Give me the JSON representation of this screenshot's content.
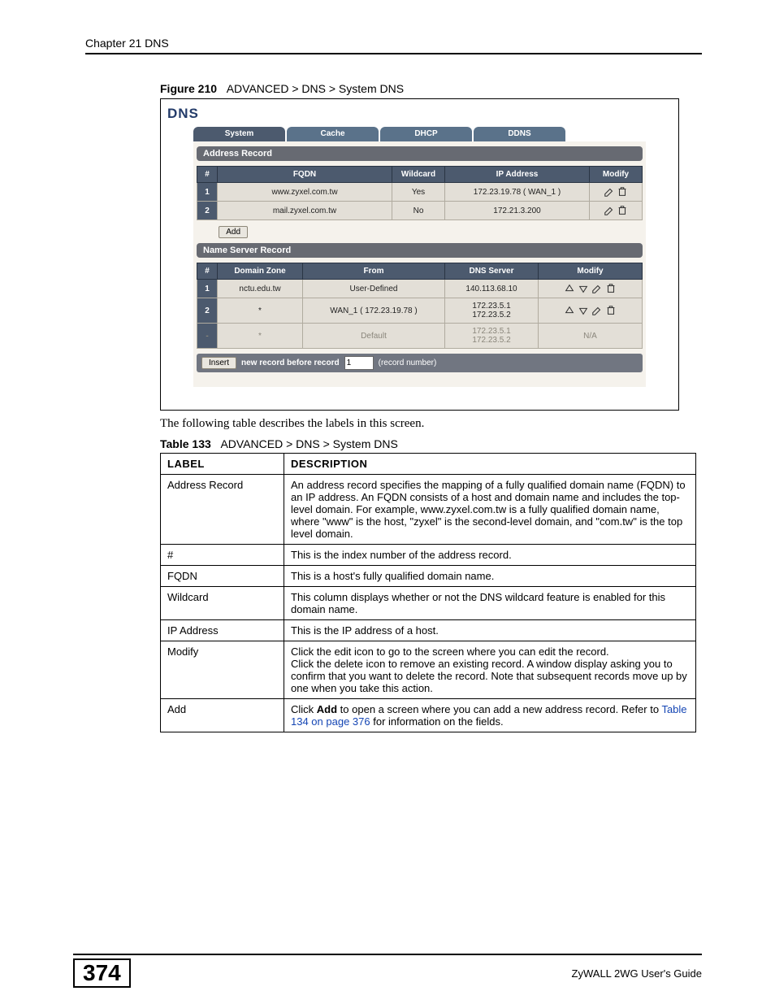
{
  "header": {
    "chapter": "Chapter 21 DNS"
  },
  "figure": {
    "label": "Figure 210",
    "caption": "ADVANCED > DNS > System DNS"
  },
  "screen": {
    "title": "DNS",
    "tabs": [
      "System",
      "Cache",
      "DHCP",
      "DDNS"
    ],
    "section_address": "Address Record",
    "address_headers": {
      "idx": "#",
      "fqdn": "FQDN",
      "wildcard": "Wildcard",
      "ip": "IP Address",
      "modify": "Modify"
    },
    "address_rows": [
      {
        "idx": "1",
        "fqdn": "www.zyxel.com.tw",
        "wildcard": "Yes",
        "ip": "172.23.19.78 ( WAN_1 )"
      },
      {
        "idx": "2",
        "fqdn": "mail.zyxel.com.tw",
        "wildcard": "No",
        "ip": "172.21.3.200"
      }
    ],
    "add_label": "Add",
    "section_ns": "Name Server Record",
    "ns_headers": {
      "idx": "#",
      "zone": "Domain Zone",
      "from": "From",
      "server": "DNS Server",
      "modify": "Modify"
    },
    "ns_rows": [
      {
        "idx": "1",
        "zone": "nctu.edu.tw",
        "from": "User-Defined",
        "server": "140.113.68.10",
        "modify": "udme"
      },
      {
        "idx": "2",
        "zone": "*",
        "from": "WAN_1 ( 172.23.19.78 )",
        "server": "172.23.5.1\n172.23.5.2",
        "modify": "udme"
      },
      {
        "idx": "-",
        "zone": "*",
        "from": "Default",
        "server": "172.23.5.1\n172.23.5.2",
        "modify": "N/A",
        "dim": true
      }
    ],
    "insert_btn": "Insert",
    "insert_text1": "new record before record",
    "insert_value": "1",
    "insert_text2": "(record number)"
  },
  "intro": "The following table describes the labels in this screen.",
  "tablecap": {
    "label": "Table 133",
    "caption": "ADVANCED > DNS > System DNS"
  },
  "desc_headers": {
    "label": "LABEL",
    "description": "DESCRIPTION"
  },
  "desc_rows": [
    {
      "label": "Address Record",
      "desc_html": "An address record specifies the mapping of a fully qualified domain name (FQDN) to an IP address. An FQDN consists of a host and domain name and includes the top-level domain. For example, www.zyxel.com.tw is a fully qualified domain name, where \"www\" is the host, \"zyxel\" is the second-level domain, and \"com.tw\" is the top level domain."
    },
    {
      "label": "#",
      "desc_html": "This is the index number of the address record."
    },
    {
      "label": "FQDN",
      "desc_html": "This is a host's fully qualified domain name."
    },
    {
      "label": "Wildcard",
      "desc_html": "This column displays whether or not the DNS wildcard feature is enabled for this domain name."
    },
    {
      "label": "IP Address",
      "desc_html": "This is the IP address of a host."
    },
    {
      "label": "Modify",
      "desc_html": "Click the edit icon to go to the screen where you can edit the record.<br>Click the delete icon to remove an existing record. A window display asking you to confirm that you want to delete the record. Note that subsequent records move up by one when you take this action."
    },
    {
      "label": "Add",
      "desc_html": "Click <b>Add</b> to open a screen where you can add a new address record. Refer to <span class=\"link\">Table 134 on page 376</span> for information on the fields."
    }
  ],
  "footer": {
    "page_number": "374",
    "guide": "ZyWALL 2WG User's Guide"
  }
}
